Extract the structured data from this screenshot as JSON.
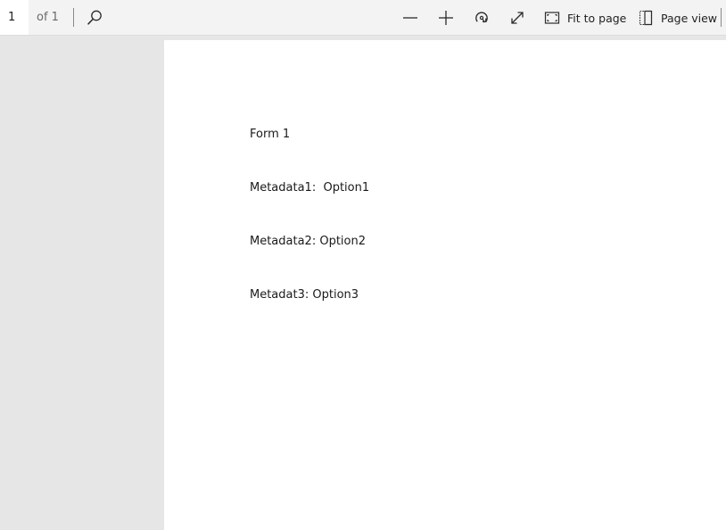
{
  "toolbar": {
    "page_number": "1",
    "page_of": "of 1",
    "buttons": {
      "search_icon": "search-icon",
      "zoom_out_icon": "minus-icon",
      "zoom_in_icon": "plus-icon",
      "rotate_icon": "rotate-icon",
      "fullscreen_icon": "expand-icon",
      "fit_to_page": {
        "label": "Fit to page",
        "icon": "fit-to-page-icon"
      },
      "page_view": {
        "label": "Page view",
        "icon": "page-view-icon"
      }
    }
  },
  "document": {
    "lines": [
      "Form 1",
      "Metadata1:  Option1",
      "Metadata2: Option2",
      "Metadat3: Option3"
    ]
  }
}
